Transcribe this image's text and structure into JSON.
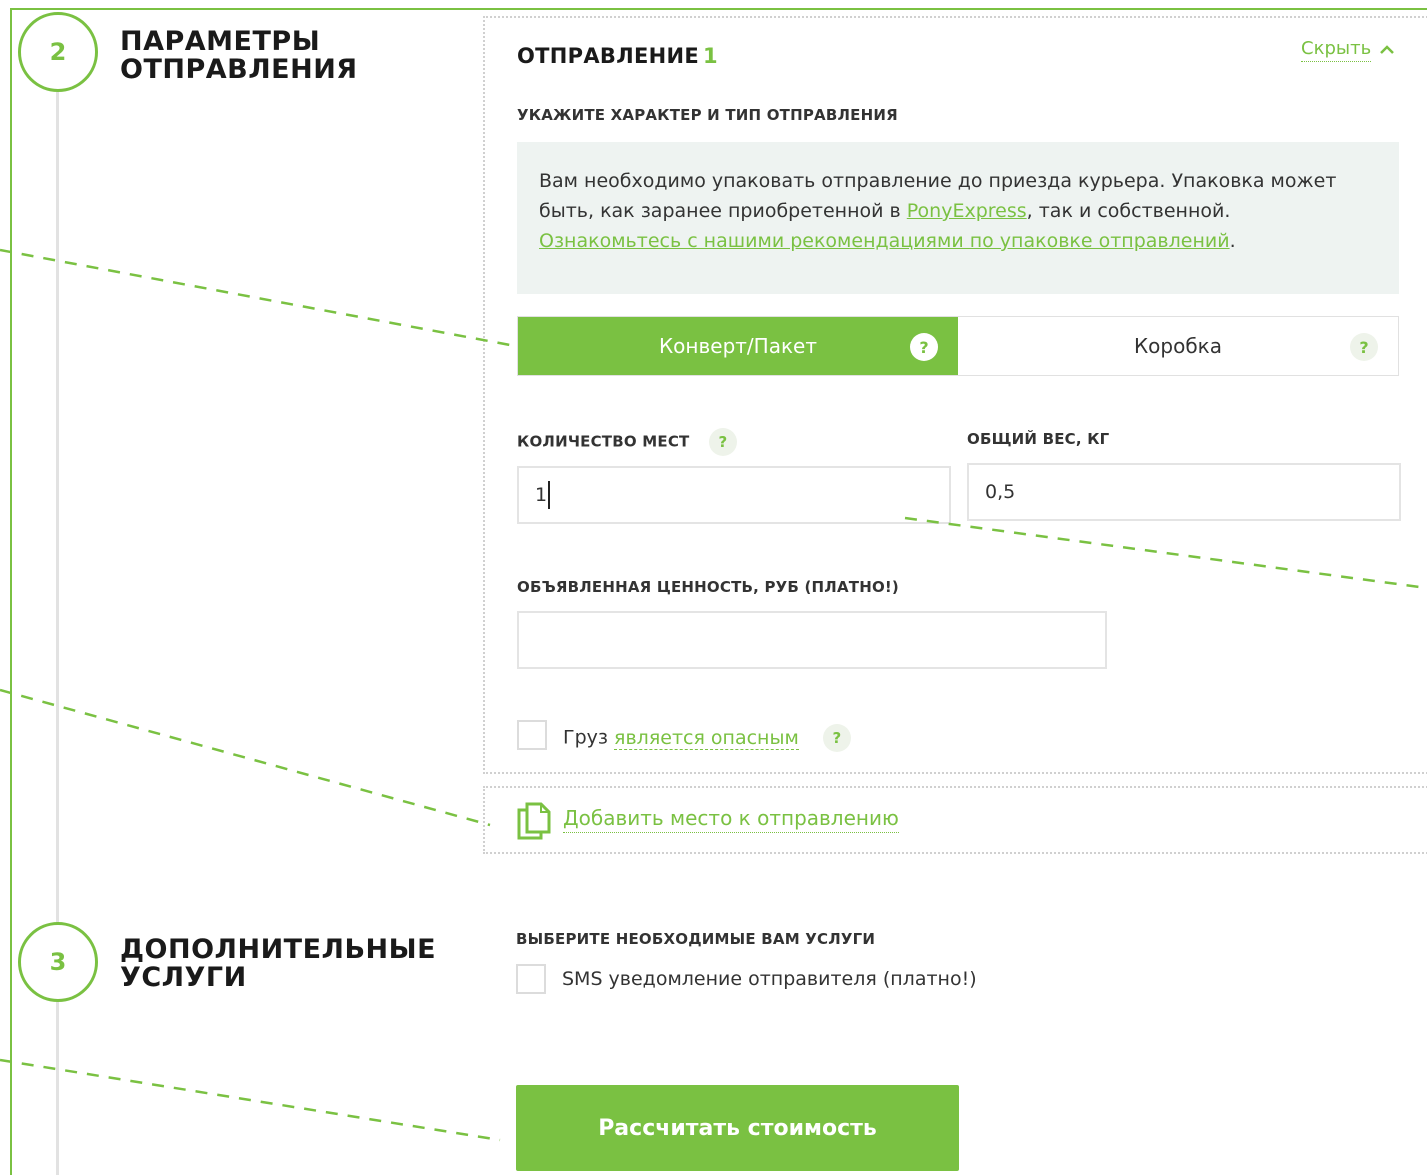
{
  "steps": [
    {
      "number": "2",
      "title_line1": "ПАРАМЕТРЫ",
      "title_line2": "ОТПРАВЛЕНИЯ"
    },
    {
      "number": "3",
      "title_line1": "ДОПОЛНИТЕЛЬНЫЕ",
      "title_line2": "УСЛУГИ"
    }
  ],
  "shipment": {
    "title": "ОТПРАВЛЕНИЕ",
    "number": "1",
    "hide_label": "Скрыть",
    "type_label": "УКАЖИТЕ ХАРАКТЕР И ТИП ОТПРАВЛЕНИЯ",
    "info": {
      "text1": "Вам необходимо упаковать отправление до приезда курьера. Упаковка может быть, как заранее приобретенной в ",
      "link1": "PonyExpress",
      "text2": ", так и собственной. ",
      "link2": "Ознакомьтесь с нашими рекомендациями по упаковке отправлений",
      "text3": "."
    },
    "types": [
      {
        "label": "Конверт/Пакет",
        "active": true
      },
      {
        "label": "Коробка",
        "active": false
      }
    ],
    "help_mark": "?",
    "places_label": "КОЛИЧЕСТВО МЕСТ",
    "places_value": "1",
    "weight_label": "ОБЩИЙ ВЕС, КГ",
    "weight_value": "0,5",
    "declared_label": "ОБЪЯВЛЕННАЯ ЦЕННОСТЬ, РУБ (ПЛАТНО!)",
    "declared_value": "",
    "danger_text": "Груз ",
    "danger_link": "является опасным"
  },
  "add_place_label": "Добавить место к отправлению",
  "services": {
    "label": "ВЫБЕРИТЕ НЕОБХОДИМЫЕ ВАМ УСЛУГИ",
    "sms_label": "SMS уведомление отправителя (платно!)"
  },
  "calc_button": "Рассчитать стоимость",
  "colors": {
    "accent": "#7ac142",
    "info_bg": "#eef3f1",
    "border": "#e4e4e4"
  }
}
